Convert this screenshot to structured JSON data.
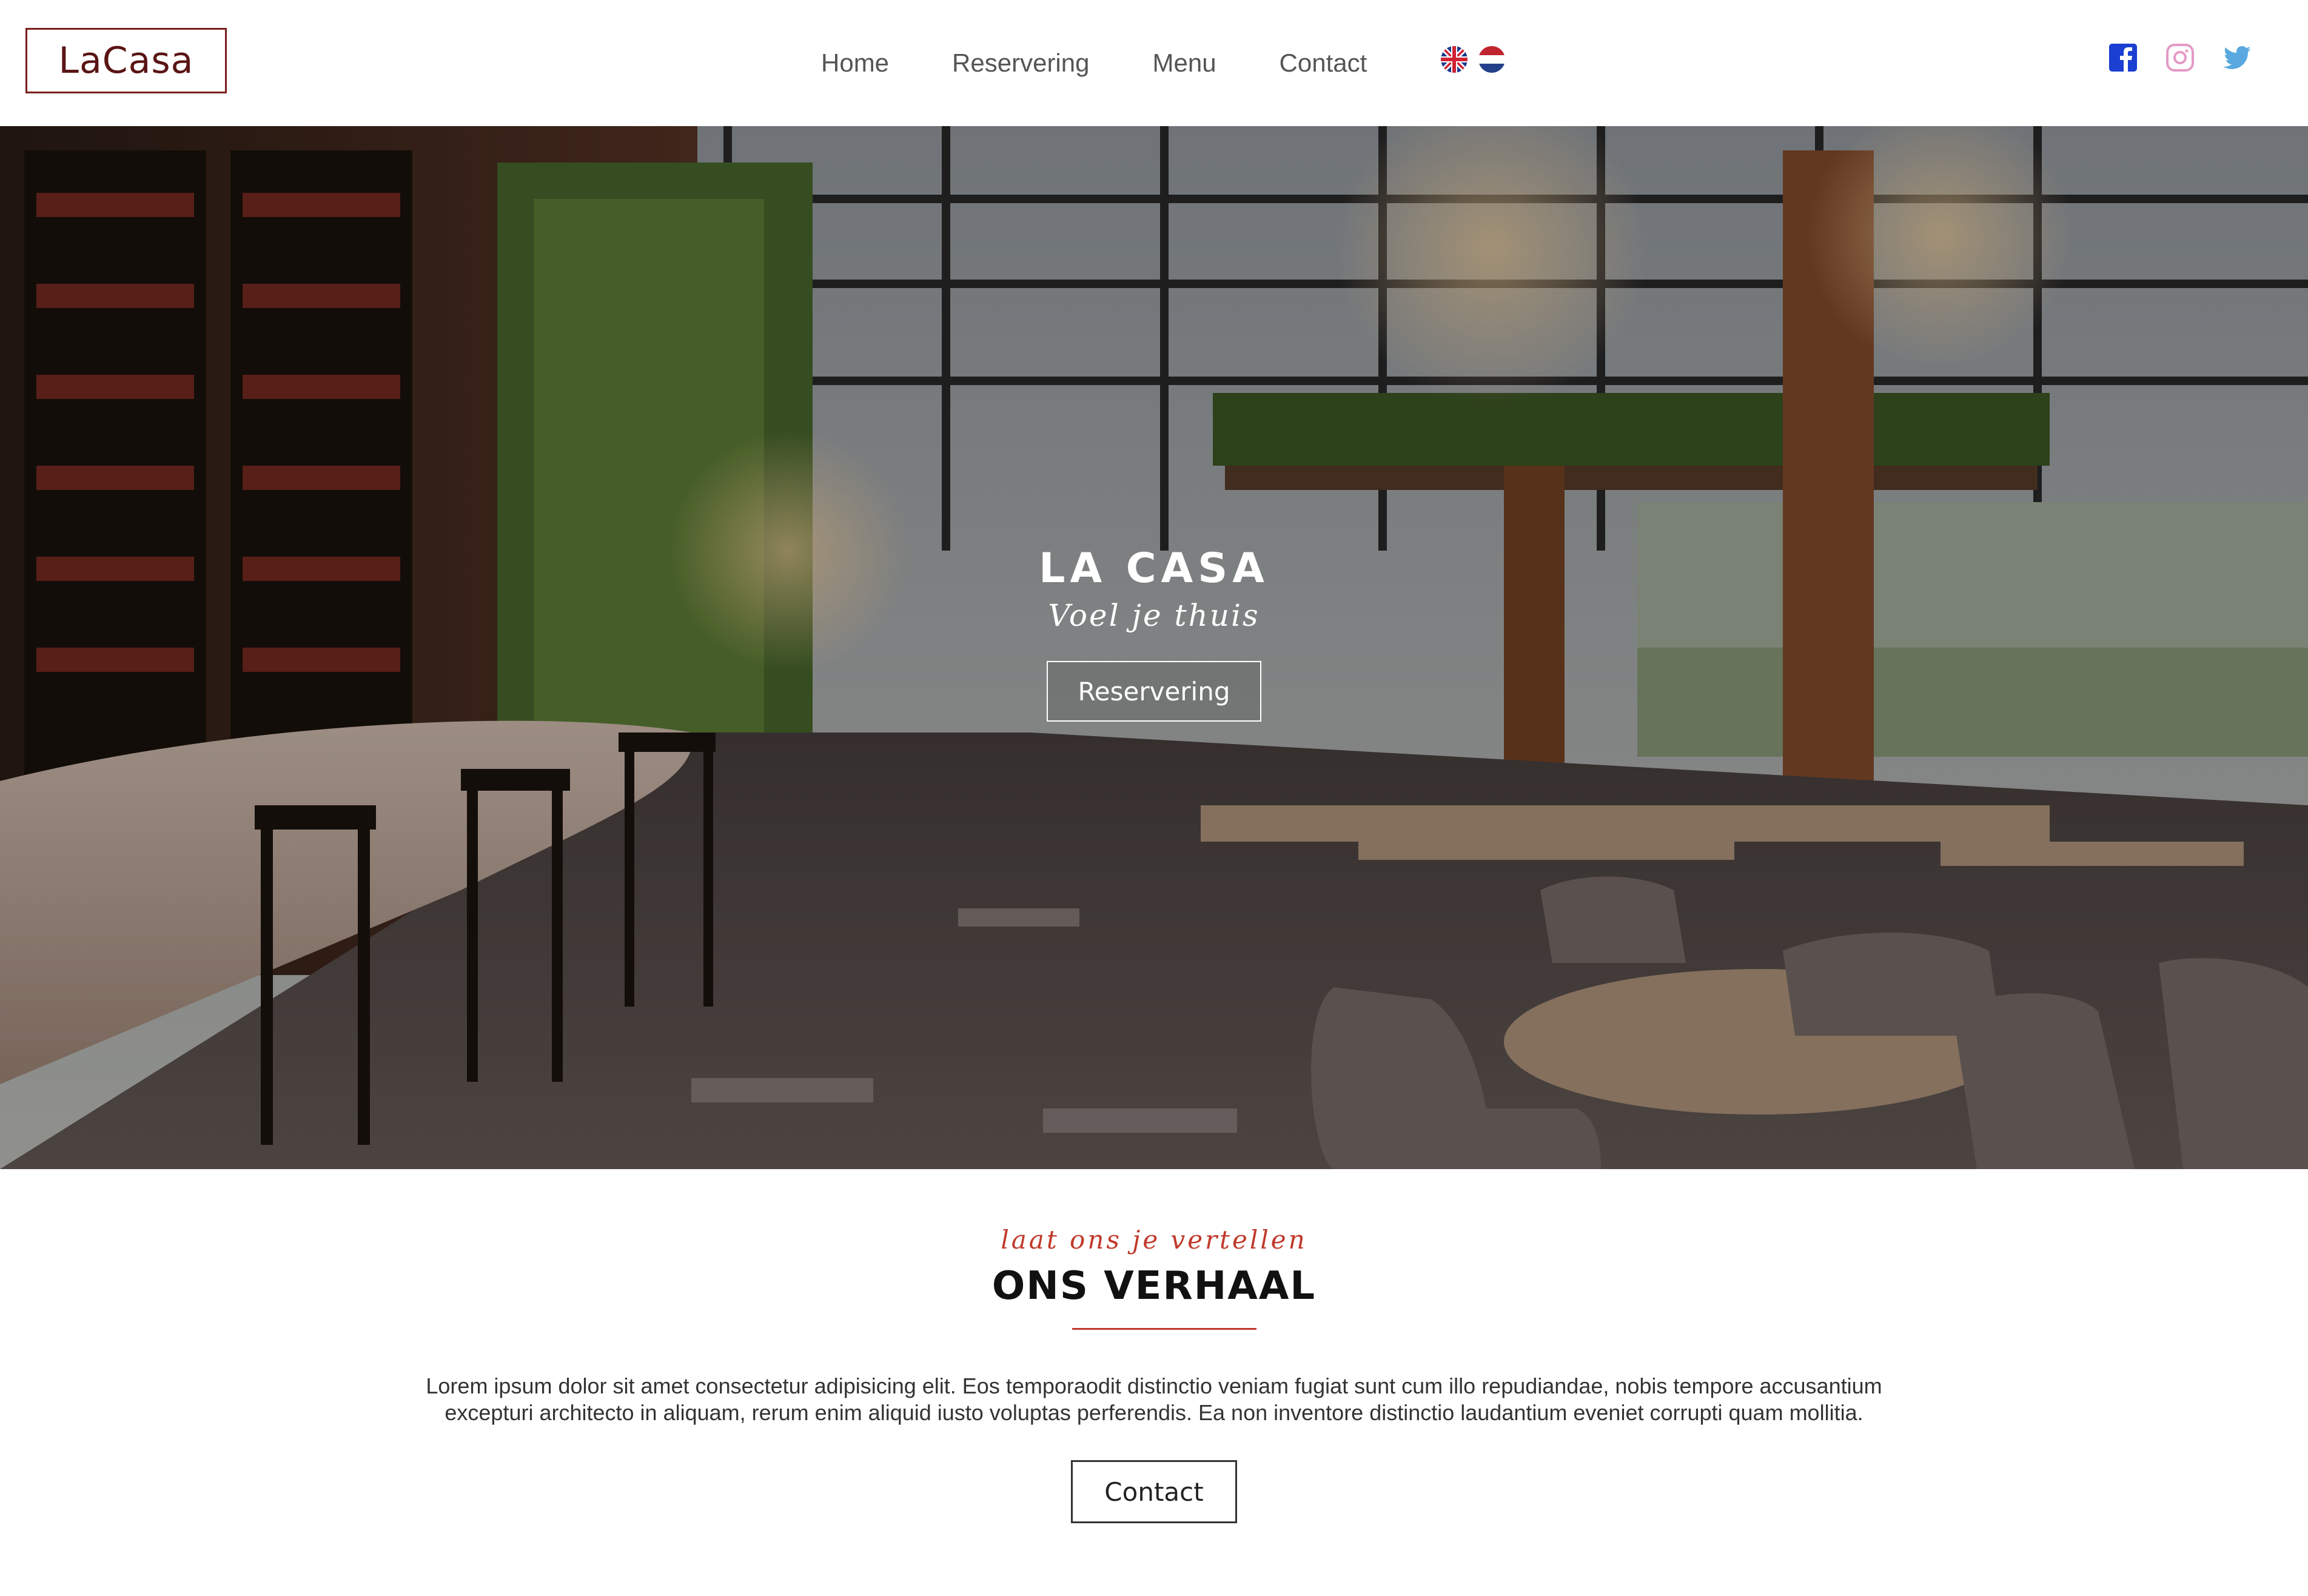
{
  "navbar": {
    "logo": "LaCasa",
    "links": [
      {
        "label": "Home"
      },
      {
        "label": "Reservering"
      },
      {
        "label": "Menu"
      },
      {
        "label": "Contact"
      }
    ],
    "flags": [
      {
        "icon": "uk-flag-icon"
      },
      {
        "icon": "nl-flag-icon"
      }
    ],
    "socials": [
      {
        "icon": "facebook-icon",
        "color": "#1a3fd1"
      },
      {
        "icon": "instagram-icon",
        "color": "#e59ac6"
      },
      {
        "icon": "twitter-icon",
        "color": "#59a9e0"
      }
    ]
  },
  "hero": {
    "title": "LA CASA",
    "subtitle": "Voel je thuis",
    "button_label": "Reservering"
  },
  "story": {
    "kicker": "laat ons je vertellen",
    "title": "ONS VERHAAL",
    "body": "Lorem ipsum dolor sit amet consectetur adipisicing elit. Eos temporaodit distinctio veniam fugiat sunt cum illo repudiandae, nobis tempore accusantium excepturi architecto in aliquam, rerum enim aliquid iusto voluptas perferendis. Ea non inventore distinctio laudantium eveniet corrupti quam mollitia.",
    "button_label": "Contact"
  },
  "colors": {
    "accent": "#c0392b",
    "logo": "#5a1414"
  }
}
